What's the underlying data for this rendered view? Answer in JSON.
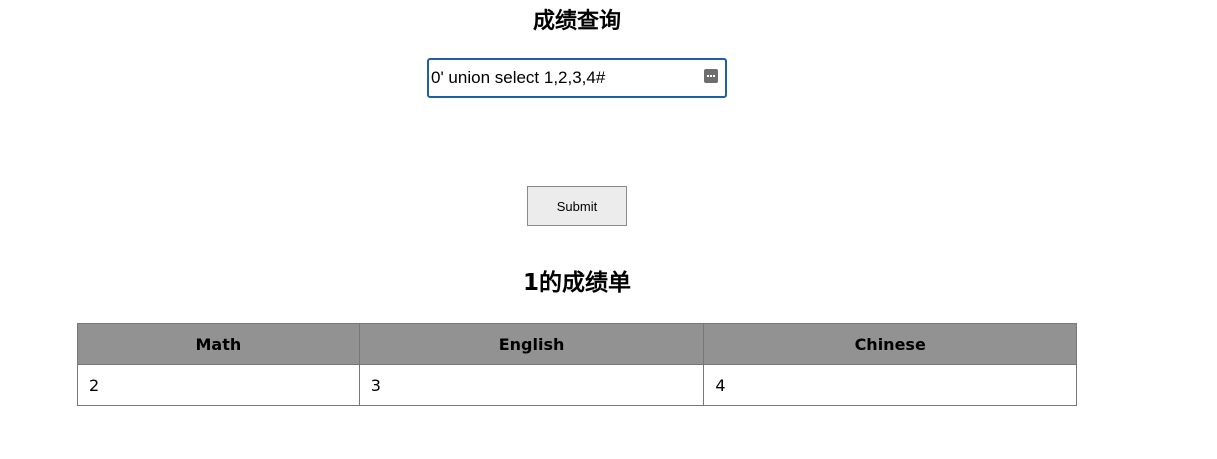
{
  "page": {
    "title": "成绩查询"
  },
  "search": {
    "value": "0' union select 1,2,3,4#",
    "icon": "more-icon"
  },
  "form": {
    "submit_label": "Submit"
  },
  "report": {
    "title": "1的成绩单"
  },
  "table": {
    "headers": [
      "Math",
      "English",
      "Chinese"
    ],
    "rows": [
      [
        "2",
        "3",
        "4"
      ]
    ]
  },
  "colors": {
    "input_border": "#1f5fa8",
    "header_bg": "#929292",
    "table_border": "#777777",
    "button_bg": "#ececec"
  }
}
